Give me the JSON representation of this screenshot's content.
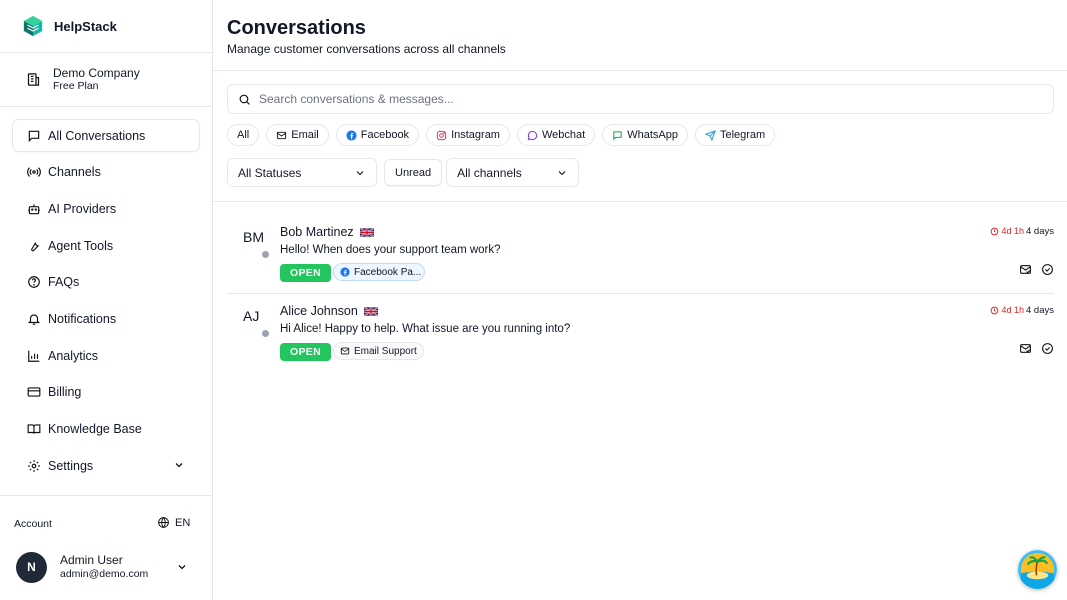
{
  "app": {
    "name": "HelpStack"
  },
  "org": {
    "name": "Demo Company",
    "plan": "Free Plan"
  },
  "sidebar": {
    "items": [
      {
        "label": "All Conversations",
        "icon": "chat-icon"
      },
      {
        "label": "Channels",
        "icon": "broadcast-icon"
      },
      {
        "label": "AI Providers",
        "icon": "bot-icon"
      },
      {
        "label": "Agent Tools",
        "icon": "wrench-icon"
      },
      {
        "label": "FAQs",
        "icon": "help-circle-icon"
      },
      {
        "label": "Notifications",
        "icon": "bell-icon"
      },
      {
        "label": "Analytics",
        "icon": "bar-chart-icon"
      },
      {
        "label": "Billing",
        "icon": "credit-card-icon"
      },
      {
        "label": "Knowledge Base",
        "icon": "book-icon"
      },
      {
        "label": "Settings",
        "icon": "gear-icon"
      }
    ],
    "active": "All Conversations"
  },
  "account": {
    "label": "Account",
    "language": "EN",
    "user": {
      "initial": "N",
      "name": "Admin User",
      "email": "admin@demo.com"
    }
  },
  "page": {
    "title": "Conversations",
    "subtitle": "Manage customer conversations across all channels"
  },
  "search": {
    "placeholder": "Search conversations & messages...",
    "value": ""
  },
  "channel_filters": [
    "All",
    "Email",
    "Facebook",
    "Instagram",
    "Webchat",
    "WhatsApp",
    "Telegram"
  ],
  "filters": {
    "status": "All Statuses",
    "unread": "Unread",
    "channel": "All channels"
  },
  "conversations": [
    {
      "initials": "BM",
      "name": "Bob Martinez",
      "flag": "uk-flag",
      "message": "Hello! When does your support team work?",
      "status": "OPEN",
      "channel": "Facebook Pa...",
      "sla": "4d 1h",
      "age": "4 days"
    },
    {
      "initials": "AJ",
      "name": "Alice Johnson",
      "flag": "uk-flag",
      "message": "Hi Alice! Happy to help. What issue are you running into?",
      "status": "OPEN",
      "channel": "Email Support",
      "sla": "4d 1h",
      "age": "4 days"
    }
  ],
  "colors": {
    "status_open": "#22c55e",
    "sla_warning": "#dc2626",
    "facebook": "#1877f2",
    "instagram": "#e1306c",
    "webchat": "#7c3aed",
    "whatsapp": "#16a34a",
    "telegram": "#229ed9",
    "brand": "#16a34a"
  }
}
